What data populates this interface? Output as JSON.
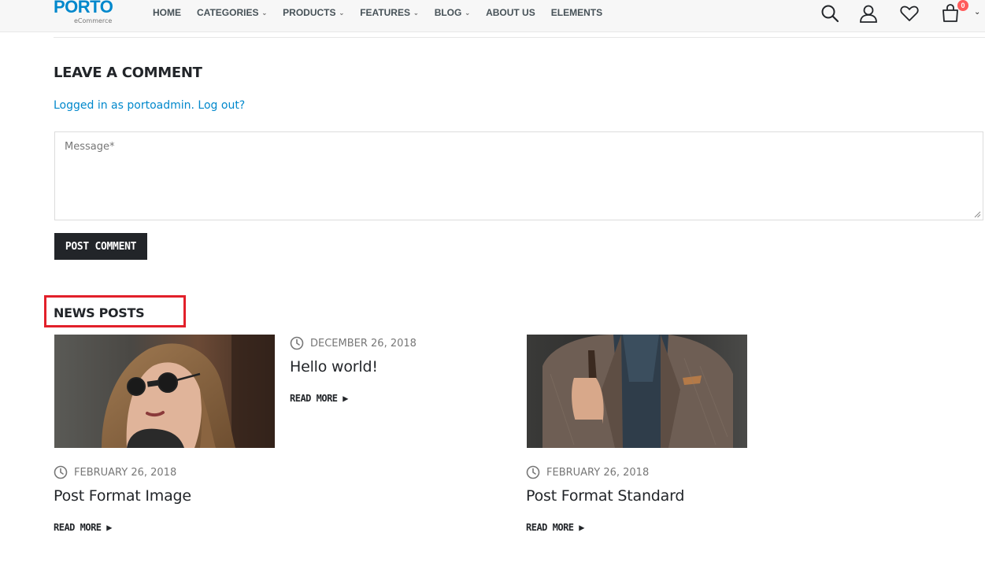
{
  "header": {
    "logo_main": "PORTO",
    "logo_sub": "eCommerce",
    "nav": [
      {
        "label": "HOME",
        "has_caret": false
      },
      {
        "label": "CATEGORIES",
        "has_caret": true
      },
      {
        "label": "PRODUCTS",
        "has_caret": true
      },
      {
        "label": "FEATURES",
        "has_caret": true
      },
      {
        "label": "BLOG",
        "has_caret": true
      },
      {
        "label": "ABOUT US",
        "has_caret": false
      },
      {
        "label": "ELEMENTS",
        "has_caret": false
      }
    ],
    "icons": [
      "search-icon",
      "user-icon",
      "heart-icon",
      "cart-icon"
    ],
    "cart_count": "0"
  },
  "comment": {
    "heading": "LEAVE A COMMENT",
    "logged_in_prefix": "Logged in as portoadmin.",
    "logout_label": "Log out?",
    "message_placeholder": "Message*",
    "submit_label": "POST COMMENT"
  },
  "news": {
    "heading": "NEWS POSTS",
    "posts": [
      {
        "date": "DECEMBER 26, 2018",
        "title": "Hello world!",
        "read_more": "READ MORE ▶"
      },
      {
        "date": "FEBRUARY 26, 2018",
        "title": "Post Format Image",
        "read_more": "READ MORE ▶"
      },
      {
        "date": "FEBRUARY 26, 2018",
        "title": "Post Format Standard",
        "read_more": "READ MORE ▶"
      }
    ]
  },
  "colors": {
    "brand": "#0088cc",
    "dark": "#222529",
    "highlight_frame": "#e2202a",
    "badge": "#ff5b5b"
  }
}
